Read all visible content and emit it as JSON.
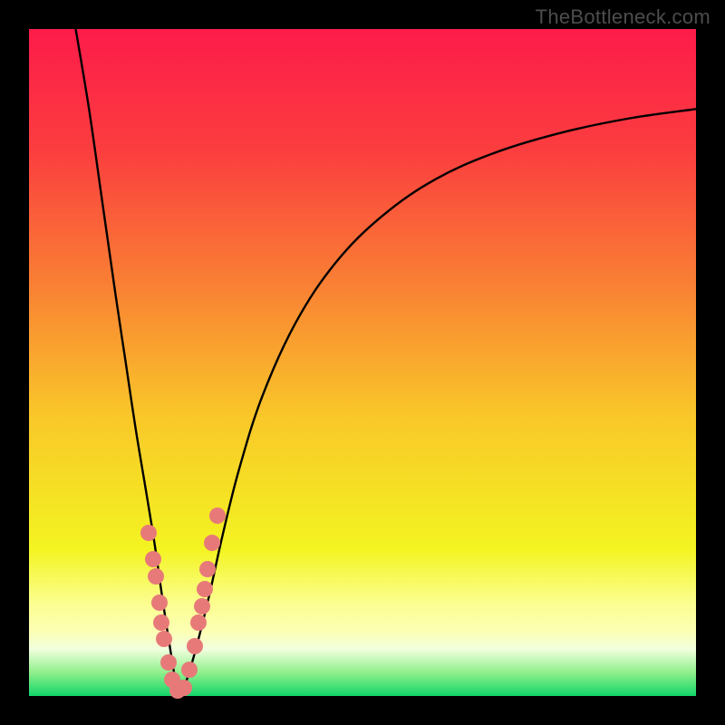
{
  "watermark": "TheBottleneck.com",
  "colors": {
    "frame": "#000000",
    "gradient_stops": [
      {
        "offset": 0.0,
        "color": "#fd1b4a"
      },
      {
        "offset": 0.18,
        "color": "#fb3d3f"
      },
      {
        "offset": 0.38,
        "color": "#f97f34"
      },
      {
        "offset": 0.58,
        "color": "#f9c729"
      },
      {
        "offset": 0.78,
        "color": "#f3f421"
      },
      {
        "offset": 0.86,
        "color": "#fbfe8e"
      },
      {
        "offset": 0.905,
        "color": "#fcffb6"
      },
      {
        "offset": 0.93,
        "color": "#f1ffde"
      },
      {
        "offset": 0.965,
        "color": "#8fef8a"
      },
      {
        "offset": 1.0,
        "color": "#12d66b"
      }
    ],
    "curve_stroke": "#000000",
    "marker_fill": "#e77a79"
  },
  "chart_data": {
    "type": "line",
    "title": "",
    "xlabel": "",
    "ylabel": "",
    "xlim": [
      0,
      100
    ],
    "ylim": [
      0,
      100
    ],
    "grid": false,
    "series": [
      {
        "name": "bottleneck-curve",
        "x": [
          7,
          9,
          11,
          13,
          14.5,
          16,
          17.5,
          18.8,
          19.8,
          20.7,
          21.5,
          22.0,
          22.5,
          23.5,
          25.0,
          27.0,
          29.0,
          31.5,
          35.0,
          40.0,
          46.0,
          53.0,
          61.0,
          70.0,
          80.0,
          90.0,
          100.0
        ],
        "y": [
          100,
          88,
          74,
          60,
          50,
          40,
          31,
          23,
          16,
          10,
          5,
          2,
          0.5,
          2,
          7,
          15,
          24,
          34,
          45,
          56,
          65,
          72,
          77.5,
          81.5,
          84.5,
          86.6,
          88.0
        ]
      }
    ],
    "markers": {
      "name": "highlight-dots",
      "x": [
        18.0,
        18.6,
        19.0,
        19.5,
        19.9,
        20.3,
        20.9,
        21.5,
        22.3,
        23.2,
        24.1,
        24.8,
        25.4,
        25.9,
        26.3,
        26.8,
        27.5,
        28.3
      ],
      "y": [
        24.5,
        20.5,
        18.0,
        14.0,
        11.0,
        8.5,
        5.0,
        2.5,
        0.8,
        1.2,
        4.0,
        7.5,
        11.0,
        13.5,
        16.0,
        19.0,
        23.0,
        27.0
      ]
    }
  }
}
